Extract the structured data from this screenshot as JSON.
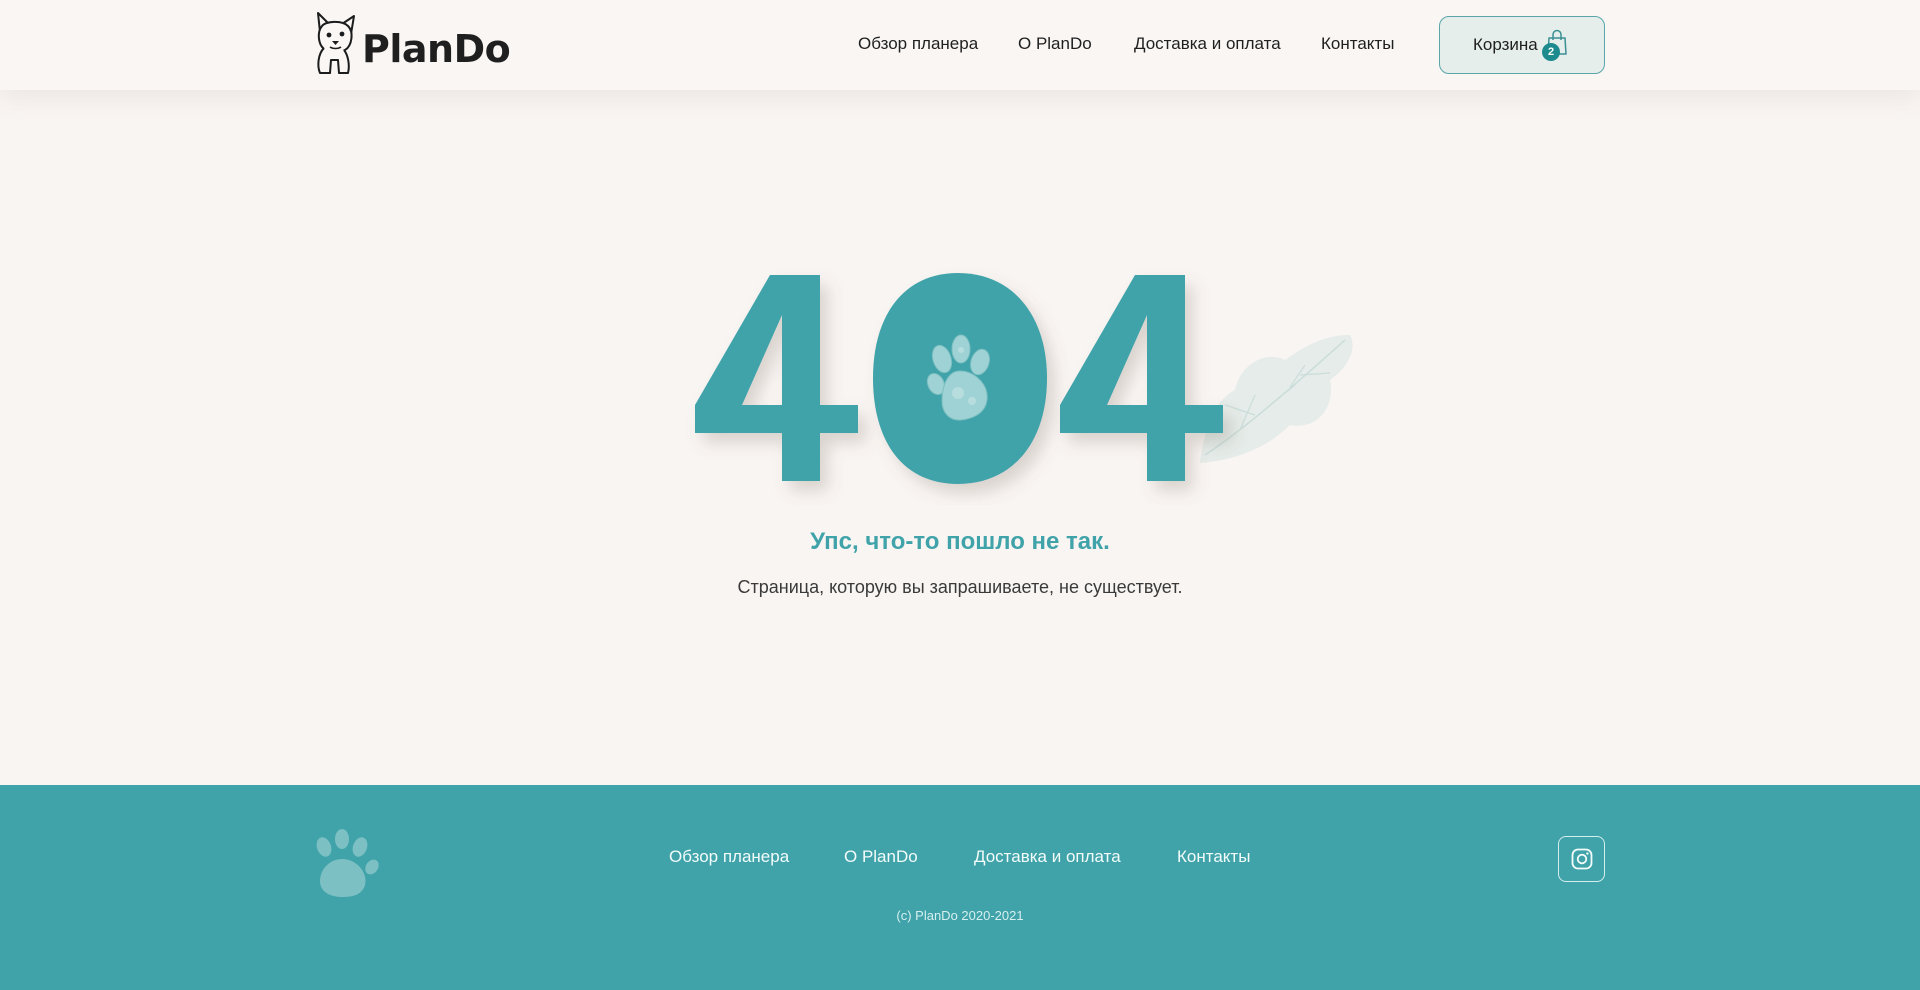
{
  "header": {
    "logo_text": "PlanDo",
    "nav": [
      {
        "label": "Обзор планера"
      },
      {
        "label": "О PlanDo"
      },
      {
        "label": "Доставка и оплата"
      },
      {
        "label": "Контакты"
      }
    ],
    "cart": {
      "label": "Корзина",
      "count": "2",
      "icon": "shopping-bag-icon"
    }
  },
  "error": {
    "code": "404",
    "title": "Упс, что-то пошло не так.",
    "message": "Страница, которую вы запрашиваете, не существует."
  },
  "footer": {
    "nav": [
      {
        "label": "Обзор планера"
      },
      {
        "label": "О PlanDo"
      },
      {
        "label": "Доставка и оплата"
      },
      {
        "label": "Контакты"
      }
    ],
    "copyright": "(c) PlanDo 2020-2021",
    "social_icon": "instagram-icon"
  },
  "colors": {
    "accent": "#3fa3a9",
    "background": "#f9f5f3",
    "badge": "#1d8a8e"
  }
}
